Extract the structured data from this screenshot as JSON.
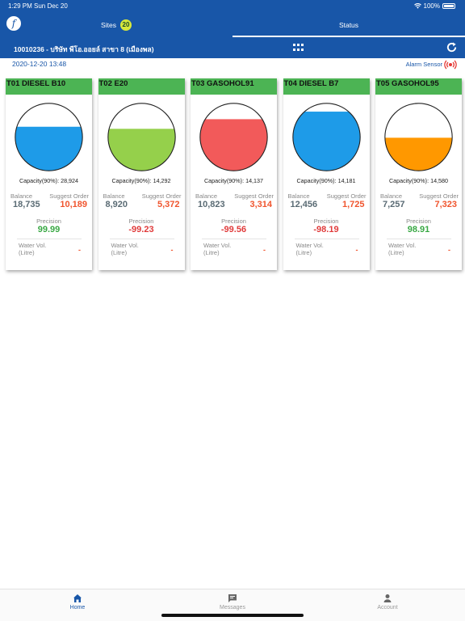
{
  "statusbar": {
    "time": "1:29 PM",
    "date": "Sun Dec 20",
    "battery": "100%"
  },
  "logo": {
    "glyph": "f"
  },
  "tabs": {
    "sites": {
      "label": "Sites",
      "count": "20"
    },
    "status": {
      "label": "Status"
    }
  },
  "site": {
    "name": "10010236 - บริษัท พีโอ.ออยล์ สาขา 8 (เมืองพล)"
  },
  "timestamp": "2020-12-20 13:48",
  "alarm": {
    "label": "Alarm Sensor"
  },
  "labels": {
    "balance": "Balance",
    "suggest_order": "Suggest Order",
    "precision": "Precision",
    "water_vol_1": "Water Vol.",
    "water_vol_2": "(Litre)"
  },
  "tanks": [
    {
      "name": "T01 DIESEL B10",
      "capacity": "Capacity(90%): 28,924",
      "balance": "18,735",
      "suggest_order": "10,189",
      "precision": "99.99",
      "water_vol": "-",
      "fill_color": "#1e9be8",
      "level": 0.65,
      "precision_color": "#39a844"
    },
    {
      "name": "T02 E20",
      "capacity": "Capacity(90%): 14,292",
      "balance": "8,920",
      "suggest_order": "5,372",
      "precision": "-99.23",
      "water_vol": "-",
      "fill_color": "#95d04b",
      "level": 0.62,
      "precision_color": "#e03b3b"
    },
    {
      "name": "T03 GASOHOL91",
      "capacity": "Capacity(90%): 14,137",
      "balance": "10,823",
      "suggest_order": "3,314",
      "precision": "-99.56",
      "water_vol": "-",
      "fill_color": "#f25a5a",
      "level": 0.76,
      "precision_color": "#e03b3b"
    },
    {
      "name": "T04 DIESEL B7",
      "capacity": "Capacity(90%): 14,181",
      "balance": "12,456",
      "suggest_order": "1,725",
      "precision": "-98.19",
      "water_vol": "-",
      "fill_color": "#1e9be8",
      "level": 0.87,
      "precision_color": "#e03b3b"
    },
    {
      "name": "T05 GASOHOL95",
      "capacity": "Capacity(90%): 14,580",
      "balance": "7,257",
      "suggest_order": "7,323",
      "precision": "98.91",
      "water_vol": "-",
      "fill_color": "#ff9800",
      "level": 0.49,
      "precision_color": "#39a844"
    }
  ],
  "tabbar": {
    "home": {
      "label": "Home",
      "icon": "home-icon"
    },
    "messages": {
      "label": "Messages",
      "icon": "message-icon"
    },
    "account": {
      "label": "Account",
      "icon": "person-icon"
    }
  },
  "colors": {
    "brand": "#1856a8",
    "header_green": "#4cb454",
    "order": "#f0542d"
  }
}
